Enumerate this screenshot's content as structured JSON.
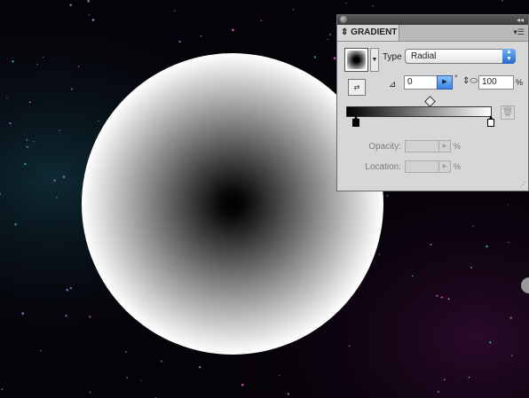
{
  "background_color": "#050208",
  "gradient_circle": {
    "type": "radial",
    "inner_color": "#000000",
    "outer_color": "#ffffff"
  },
  "panel": {
    "tab_label": "GRADIENT",
    "tab_icon": "collapse-arrows-icon",
    "type_label": "Type",
    "type_value": "Radial",
    "angle_value": "0",
    "angle_unit": "°",
    "aspect_value": "100",
    "aspect_unit": "%",
    "opacity_label": "Opacity:",
    "opacity_unit": "%",
    "location_label": "Location:",
    "location_unit": "%",
    "ramp_start_color": "#000000",
    "ramp_end_color": "#ffffff",
    "accent_color": "#3a82e0"
  }
}
